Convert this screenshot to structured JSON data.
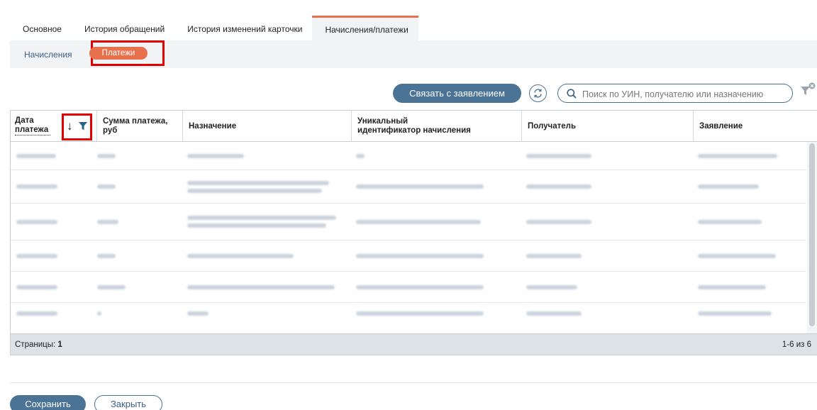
{
  "tabs": [
    {
      "label": "Основное"
    },
    {
      "label": "История обращений"
    },
    {
      "label": "История изменений карточки"
    },
    {
      "label": "Начисления/платежи",
      "active": true
    }
  ],
  "subtabs": {
    "charges": "Начисления",
    "payments": "Платежи"
  },
  "toolbar": {
    "link_button": "Связать с заявлением",
    "search_placeholder": "Поиск по УИН, получателю или назначению",
    "refresh_icon": "refresh-icon",
    "search_icon": "search-icon",
    "filter_clear_icon": "filter-clear-icon"
  },
  "table": {
    "columns": {
      "date": "Дата платежа",
      "amount": "Сумма платежа, руб",
      "purpose": "Назначение",
      "uin": "Уникальный идентификатор начисления",
      "recipient": "Получатель",
      "application": "Заявление"
    },
    "rows_note": "Row values are obscured (blurred) in the screenshot",
    "footer": {
      "pages_label": "Страницы:",
      "pages_value": "1",
      "count": "1-6 из 6"
    }
  },
  "footer": {
    "save": "Сохранить",
    "close": "Закрыть"
  },
  "colors": {
    "accent": "#e8714d",
    "primary": "#4a7396",
    "highlight": "#e00000"
  }
}
